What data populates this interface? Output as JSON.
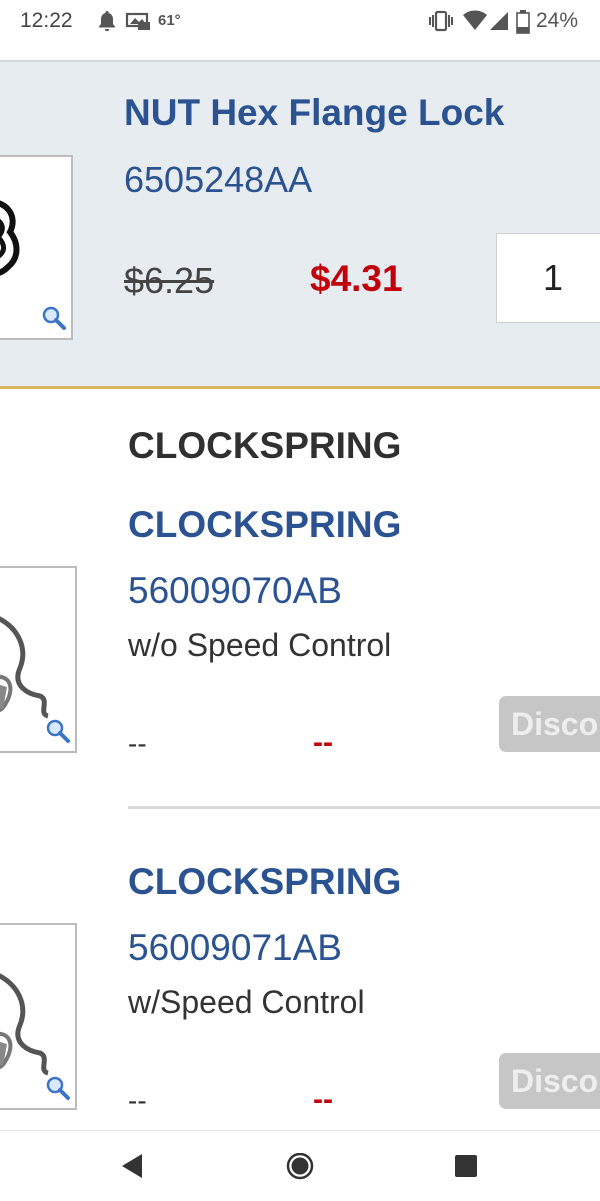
{
  "status_bar": {
    "time": "12:22",
    "temperature": "61°",
    "battery": "24%",
    "icons": [
      "notification-bell-icon",
      "weather-icon",
      "vibrate-icon",
      "wifi-icon",
      "signal-icon",
      "battery-icon"
    ]
  },
  "featured_part": {
    "title": "NUT Hex Flange Lock",
    "part_number": "6505248AA",
    "original_price": "$6.25",
    "sale_price": "$4.31",
    "quantity": "1"
  },
  "section": {
    "heading": "CLOCKSPRING"
  },
  "items": [
    {
      "name": "CLOCKSPRING",
      "part_number": "56009070AB",
      "description": "w/o Speed Control",
      "list_price": "--",
      "sale_price": "--",
      "button_label": "Disco"
    },
    {
      "name": "CLOCKSPRING",
      "part_number": "56009071AB",
      "description": "w/Speed Control",
      "list_price": "--",
      "sale_price": "--",
      "button_label": "Disco"
    }
  ],
  "nav_bar": {
    "icons": [
      "back-icon",
      "home-icon",
      "recents-icon"
    ]
  },
  "colors": {
    "brand_blue": "#2b5291",
    "sale_red": "#c1000b",
    "featured_background": "#e7ecf1",
    "accent_gold": "#d8b45c"
  }
}
